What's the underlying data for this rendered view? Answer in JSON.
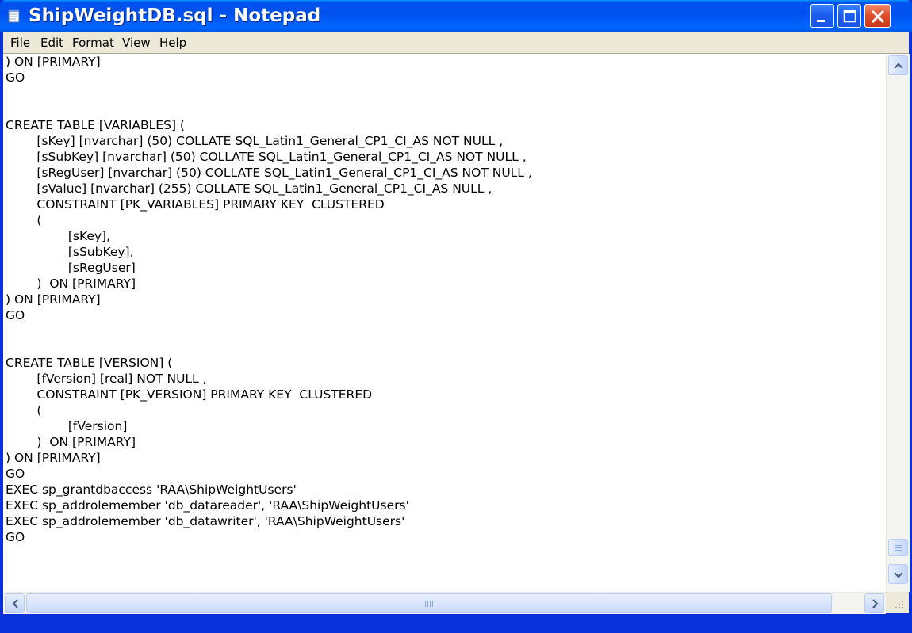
{
  "window": {
    "title": "ShipWeightDB.sql - Notepad",
    "icon": "notepad-icon"
  },
  "menu": {
    "items": [
      {
        "mnemonic": "F",
        "rest": "ile"
      },
      {
        "mnemonic": "E",
        "rest": "dit"
      },
      {
        "prefix": "F",
        "mnemonic": "o",
        "rest": "rmat"
      },
      {
        "mnemonic": "V",
        "rest": "iew"
      },
      {
        "mnemonic": "H",
        "rest": "elp"
      }
    ]
  },
  "editor": {
    "lines": [
      ") ON [PRIMARY]",
      "GO",
      "",
      "",
      "CREATE TABLE [VARIABLES] (",
      "        [sKey] [nvarchar] (50) COLLATE SQL_Latin1_General_CP1_CI_AS NOT NULL ,",
      "        [sSubKey] [nvarchar] (50) COLLATE SQL_Latin1_General_CP1_CI_AS NOT NULL ,",
      "        [sRegUser] [nvarchar] (50) COLLATE SQL_Latin1_General_CP1_CI_AS NOT NULL ,",
      "        [sValue] [nvarchar] (255) COLLATE SQL_Latin1_General_CP1_CI_AS NULL ,",
      "        CONSTRAINT [PK_VARIABLES] PRIMARY KEY  CLUSTERED",
      "        (",
      "                [sKey],",
      "                [sSubKey],",
      "                [sRegUser]",
      "        )  ON [PRIMARY]",
      ") ON [PRIMARY]",
      "GO",
      "",
      "",
      "CREATE TABLE [VERSION] (",
      "        [fVersion] [real] NOT NULL ,",
      "        CONSTRAINT [PK_VERSION] PRIMARY KEY  CLUSTERED",
      "        (",
      "                [fVersion]",
      "        )  ON [PRIMARY]",
      ") ON [PRIMARY]",
      "GO",
      "EXEC sp_grantdbaccess 'RAA\\ShipWeightUsers'",
      "EXEC sp_addrolemember 'db_datareader', 'RAA\\ShipWeightUsers'",
      "EXEC sp_addrolemember 'db_datawriter', 'RAA\\ShipWeightUsers'",
      "GO"
    ]
  },
  "colors": {
    "titlebar": "#0053ee",
    "menubar": "#ece9d8",
    "close_button": "#e0502a"
  }
}
